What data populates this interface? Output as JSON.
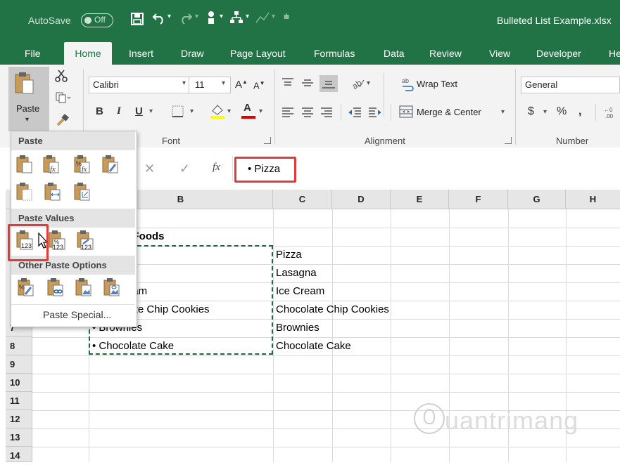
{
  "titlebar": {
    "autosave_label": "AutoSave",
    "autosave_state": "Off",
    "filename": "Bulleted List Example.xlsx"
  },
  "tabs": [
    "File",
    "Home",
    "Insert",
    "Draw",
    "Page Layout",
    "Formulas",
    "Data",
    "Review",
    "View",
    "Developer",
    "He"
  ],
  "ribbon": {
    "paste_label": "Paste",
    "font_name": "Calibri",
    "font_size": "11",
    "font_group_label": "Font",
    "alignment_group_label": "Alignment",
    "wrap_text": "Wrap Text",
    "merge_center": "Merge & Center",
    "number_format": "General",
    "number_group_label": "Number",
    "currency_symbol": "$",
    "percent_symbol": "%",
    "comma_symbol": ","
  },
  "formula_bar": {
    "value": "• Pizza",
    "fx": "fx"
  },
  "paste_menu": {
    "paste_header": "Paste",
    "paste_values_header": "Paste Values",
    "other_header": "Other Paste Options",
    "paste_special": "Paste Special..."
  },
  "columns": [
    "B",
    "C",
    "D",
    "E",
    "F",
    "G",
    "H"
  ],
  "rows": [
    "7",
    "8",
    "9",
    "10",
    "11",
    "12",
    "13",
    "14"
  ],
  "cells": {
    "b_title": "e Foods",
    "b2": "a",
    "b3": "eam",
    "b4": "late Chip Cookies",
    "b5": "• Brownies",
    "b6": "• Chocolate Cake",
    "c1": "Pizza",
    "c2": "Lasagna",
    "c3": "Ice Cream",
    "c4": "Chocolate Chip Cookies",
    "c5": "Brownies",
    "c6": "Chocolate Cake"
  },
  "watermark": "uantrimang",
  "colors": {
    "excel_green": "#217346",
    "highlight_red": "#e03b3b",
    "marquee_green": "#1e6b3a"
  }
}
